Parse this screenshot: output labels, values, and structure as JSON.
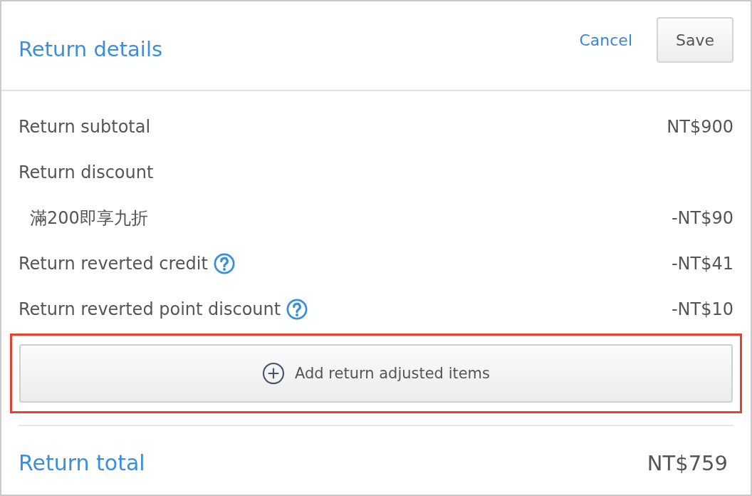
{
  "header": {
    "title": "Return details",
    "cancel": "Cancel",
    "save": "Save"
  },
  "rows": [
    {
      "kind": "line",
      "label": "Return subtotal",
      "help": false,
      "amount": "NT$900"
    },
    {
      "kind": "line",
      "label": "Return discount",
      "help": false
    },
    {
      "kind": "sub",
      "label": "滿200即享九折",
      "help": false,
      "amount": "-NT$90"
    },
    {
      "kind": "line",
      "label": "Return reverted credit",
      "help": true,
      "amount": "-NT$41"
    },
    {
      "kind": "line",
      "label": "Return reverted point discount",
      "help": true,
      "amount": "-NT$10"
    }
  ],
  "add_button": {
    "label": "Add return adjusted items",
    "highlighted": true
  },
  "total": {
    "label": "Return total",
    "amount": "NT$759"
  }
}
